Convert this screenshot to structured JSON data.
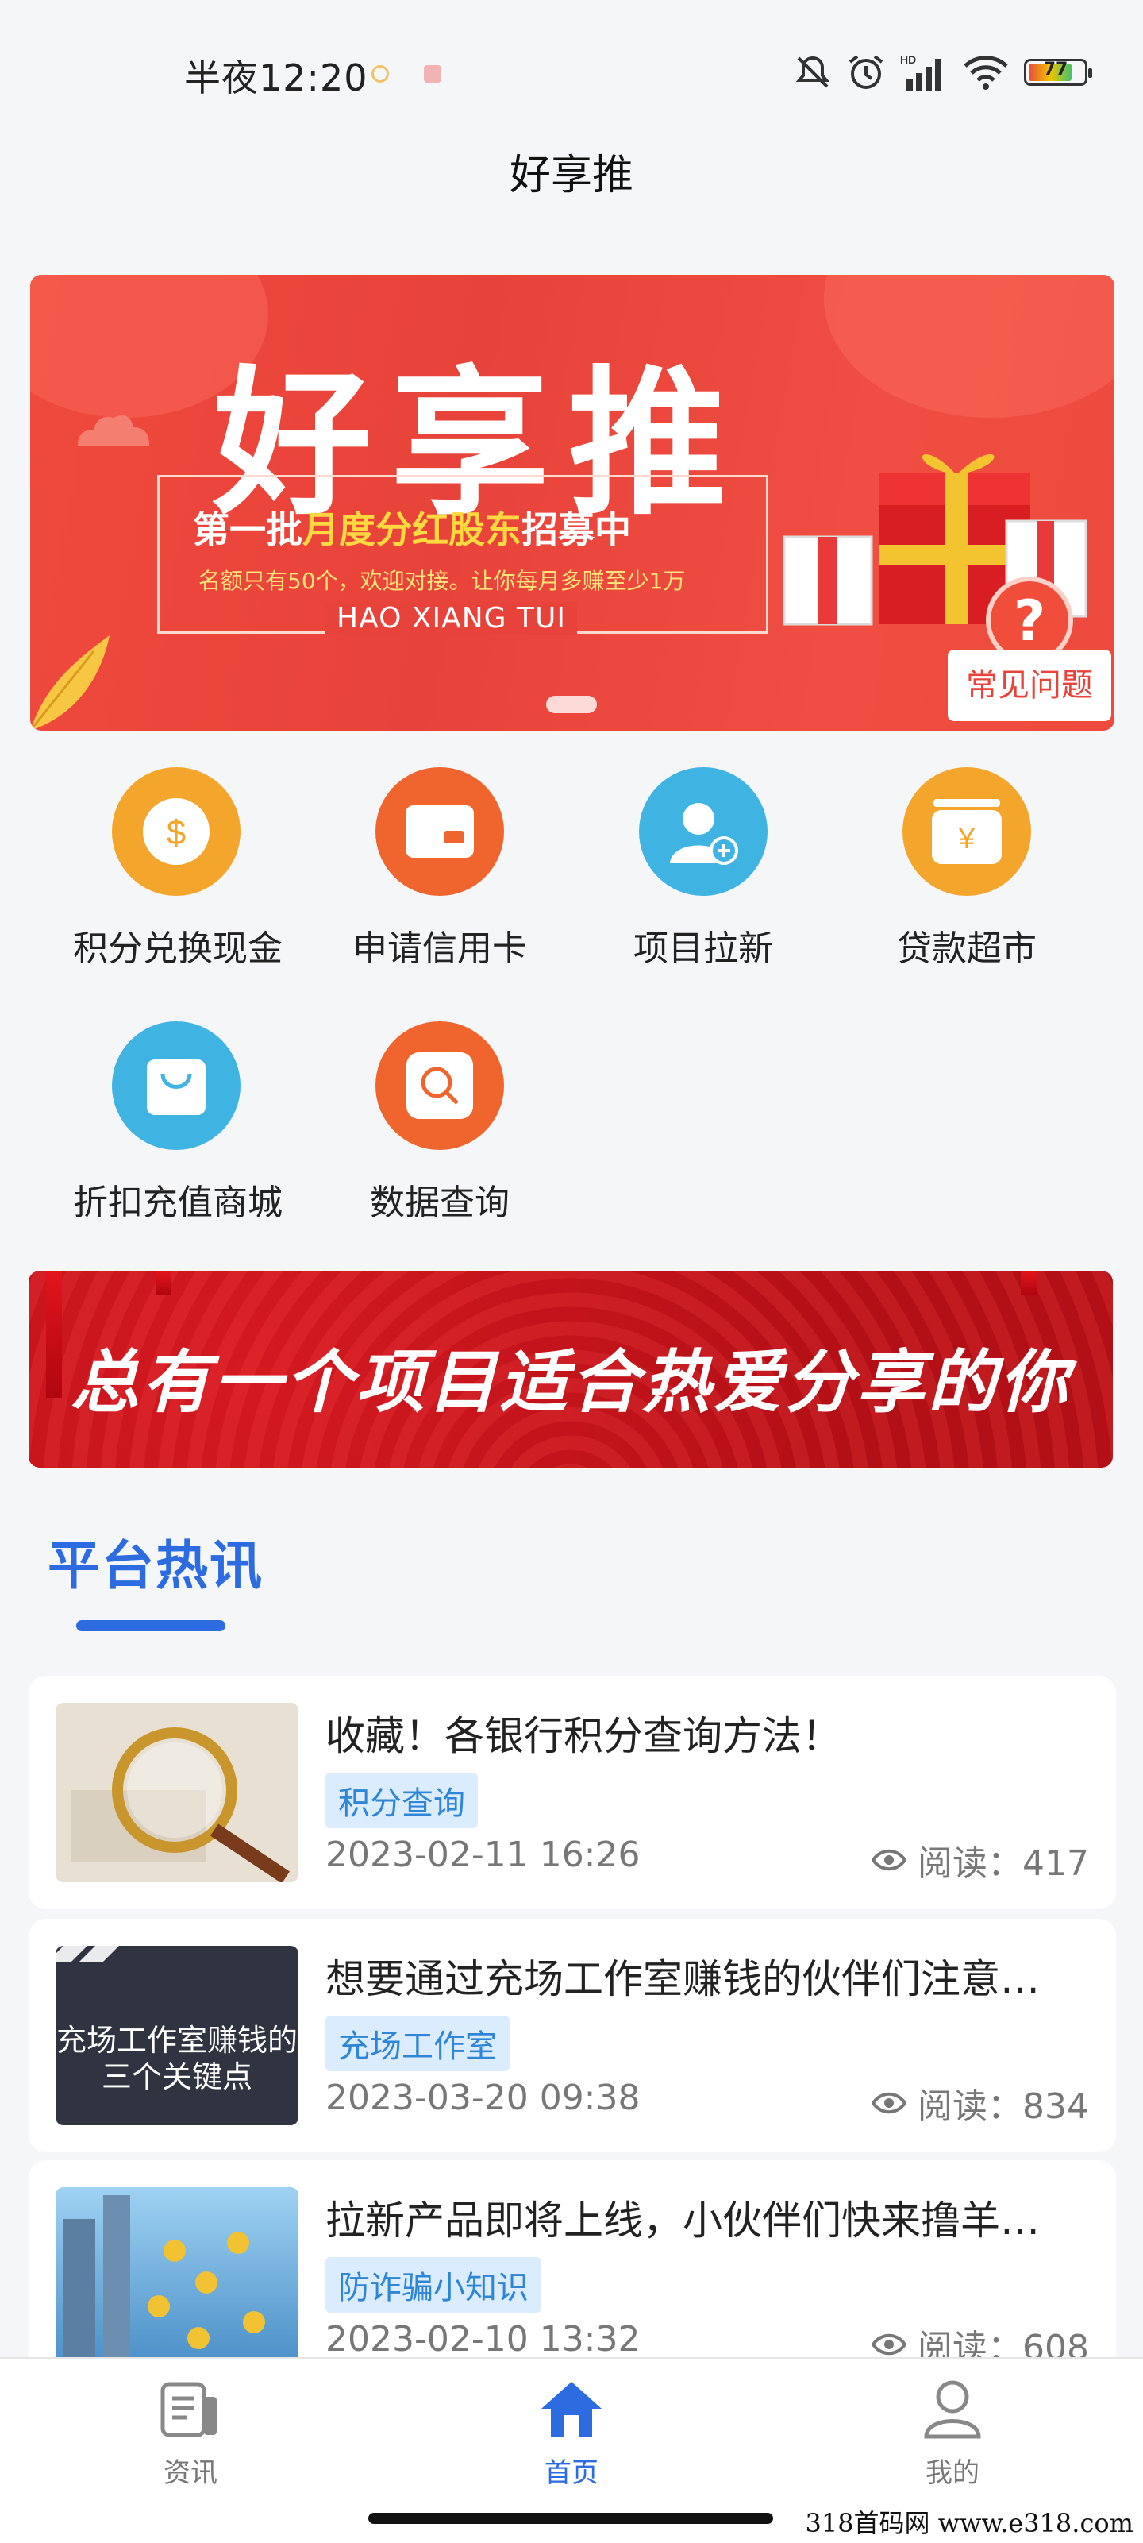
{
  "status_bar": {
    "time": "半夜12:20",
    "battery": "77"
  },
  "app": {
    "title": "好享推"
  },
  "banner": {
    "title": "好享推",
    "line1_prefix": "第一批",
    "line1_highlight": "月度分红股东",
    "line1_suffix": "招募中",
    "line2": "名额只有50个，欢迎对接。让你每月多赚至少1万",
    "line3": "HAO XIANG TUI",
    "faq_label": "常见问题",
    "faq_mark": "?"
  },
  "grid": [
    {
      "label": "积分兑换现金",
      "icon": "coin-dollar-icon",
      "color": "#f4a52c"
    },
    {
      "label": "申请信用卡",
      "icon": "credit-card-icon",
      "color": "#f0642e"
    },
    {
      "label": "项目拉新",
      "icon": "add-user-icon",
      "color": "#3fb4e3"
    },
    {
      "label": "贷款超市",
      "icon": "yen-wallet-icon",
      "color": "#f4a52c"
    },
    {
      "label": "折扣充值商城",
      "icon": "shopping-bag-icon",
      "color": "#3fb4e3"
    },
    {
      "label": "数据查询",
      "icon": "search-icon",
      "color": "#f0642e"
    }
  ],
  "slogan": {
    "text": "总有一个项目适合热爱分享的你"
  },
  "section": {
    "title": "平台热讯"
  },
  "news": [
    {
      "title": "收藏！各银行积分查询方法！",
      "tag": "积分查询",
      "date": "2023-02-11 16:26",
      "reads": "阅读：417"
    },
    {
      "title": "想要通过充场工作室赚钱的伙伴们注意…",
      "tag": "充场工作室",
      "date": "2023-03-20 09:38",
      "reads": "阅读：834",
      "thumb_text_1": "充场工作室赚钱的",
      "thumb_text_2": "三个关键点"
    },
    {
      "title": "拉新产品即将上线，小伙伴们快来撸羊…",
      "tag": "防诈骗小知识",
      "date": "2023-02-10 13:32",
      "reads": "阅读：608"
    }
  ],
  "bottom_nav": [
    {
      "label": "资讯",
      "icon": "news-icon"
    },
    {
      "label": "首页",
      "icon": "home-icon",
      "active": true
    },
    {
      "label": "我的",
      "icon": "profile-icon"
    }
  ],
  "watermark": "318首码网 www.e318.com"
}
